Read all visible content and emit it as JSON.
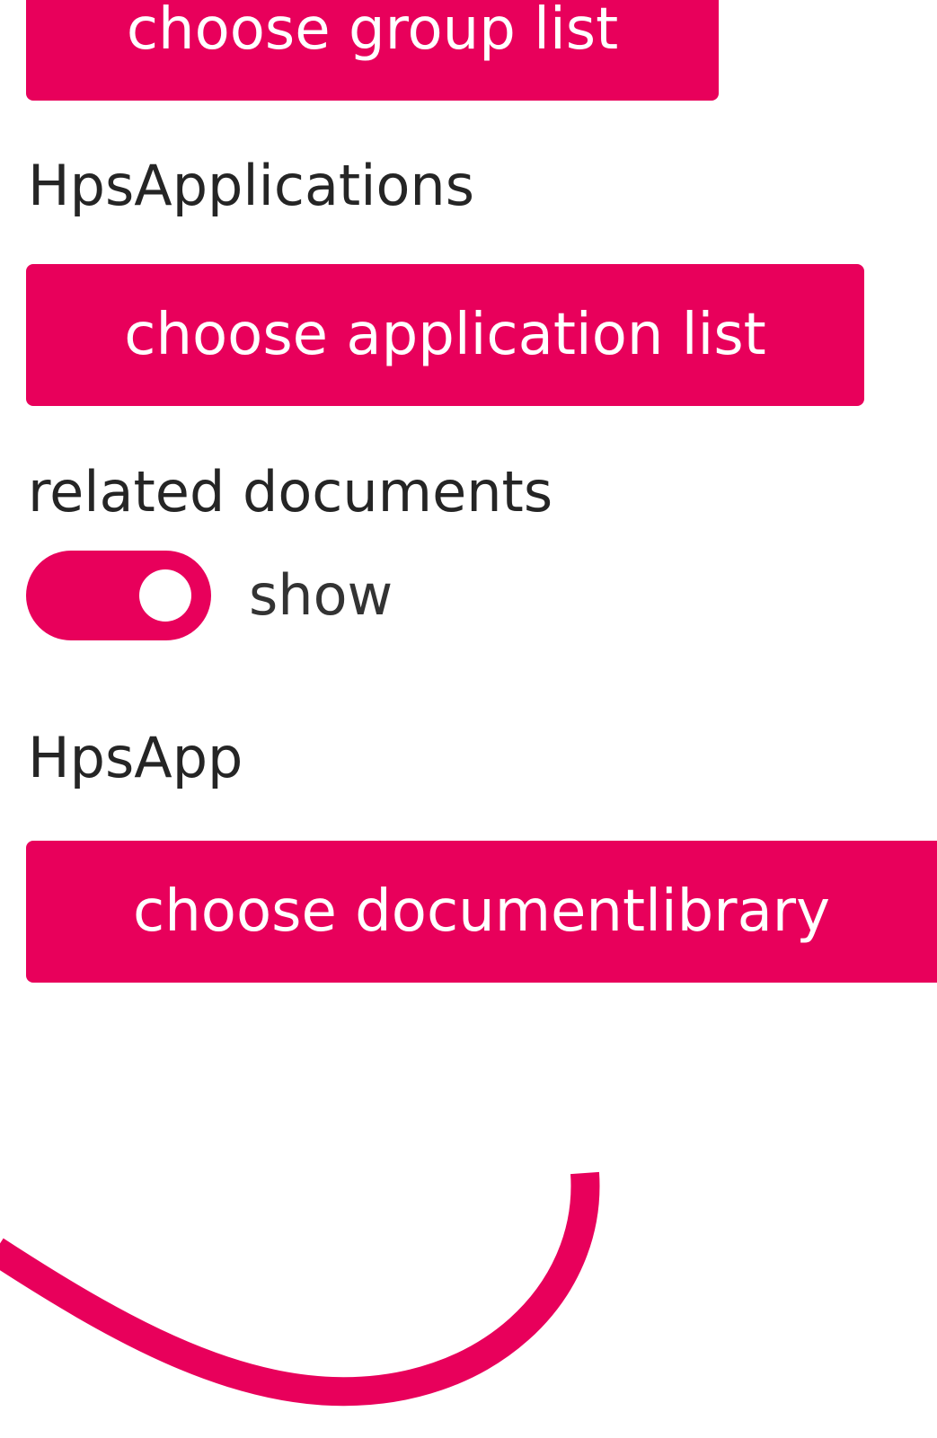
{
  "buttons": {
    "choose_group_list": "choose group list",
    "choose_application_list": "choose application list",
    "choose_documentlibrary": "choose documentlibrary"
  },
  "headings": {
    "hps_applications": "HpsApplications",
    "related_documents": "related documents",
    "hps_app": "HpsApp"
  },
  "related_documents_toggle": {
    "label": "show",
    "on": true
  },
  "colors": {
    "accent": "#e8005b",
    "text": "#252525",
    "background": "#ffffff"
  }
}
